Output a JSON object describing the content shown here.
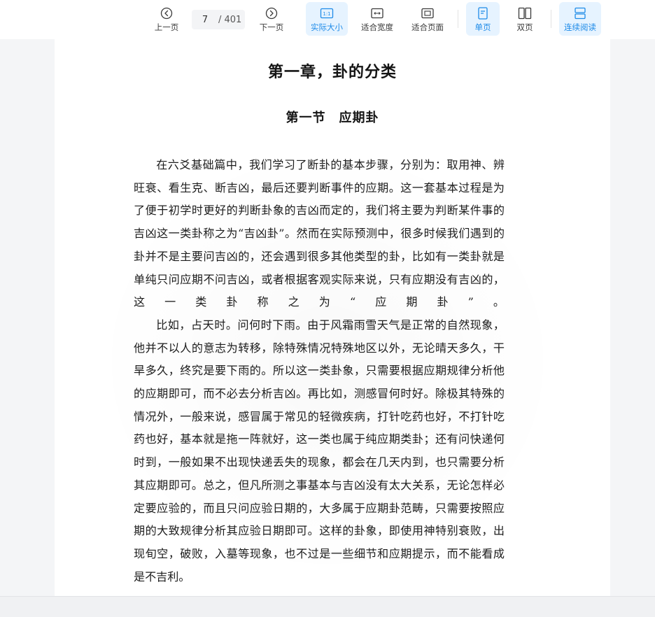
{
  "toolbar": {
    "prev_label": "上一页",
    "current_page": "7",
    "total_pages": "/ 401",
    "next_label": "下一页",
    "actual_size_label": "实际大小",
    "fit_width_label": "适合宽度",
    "fit_page_label": "适合页面",
    "single_page_label": "单页",
    "double_page_label": "双页",
    "continuous_label": "连续阅读",
    "accent_color": "#1e8be8",
    "active_bg": "#e6f3ff"
  },
  "document": {
    "chapter_title": "第一章，卦的分类",
    "section_title": "第一节　应期卦",
    "lines": [
      "在六爻基础篇中，我们学习了断卦的基本步骤，分别为：取用神、",
      "辨旺衰、看生克、断吉凶，最后还要判断事件的应期。这一套基本过程",
      "是为了便于初学时更好的判断卦象的吉凶而定的，我们将主要为判断某",
      "件事的吉凶这一类卦称之为“吉凶卦”。然而在实际预测中，很多时候",
      "我们遇到的卦并不是主要问吉凶的，还会遇到很多其他类型的卦，比如",
      "有一类卦就是单纯只问应期不问吉凶，或者根据客观实际来说，只有应",
      "期没有吉凶的，这一类卦称之为“应期卦”。",
      "比如，占天时。问何时下雨。由于风霜雨雪天气是正常的自然现象，",
      "他并不以人的意志为转移，除特殊情况特殊地区以外，无论晴天多久，",
      "干旱多久，终究是要下雨的。所以这一类卦象，只需要根据应期规律分",
      "析他的应期即可，而不必去分析吉凶。再比如，测感冒何时好。除极其",
      "特殊的情况外，一般来说，感冒属于常见的轻微疾病，打针吃药也好，",
      "不打针吃药也好，基本就是拖一阵就好，这一类也属于纯应期类卦；还",
      "有问快递何时到，一般如果不出现快递丢失的现象，都会在几天内到，",
      "也只需要分析其应期即可。总之，但凡所测之事基本与吉凶没有太大关",
      "系，无论怎样必定要应验的，而且只问应验日期的，大多属于应期卦范",
      "畴，只需要按照应期的大致规律分析其应验日期即可。这样的卦象，即",
      "使用神特别衰败，出现旬空，破败，入墓等现象，也不过是一些细节和",
      "应期提示，而不能看成是不吉利。"
    ]
  }
}
